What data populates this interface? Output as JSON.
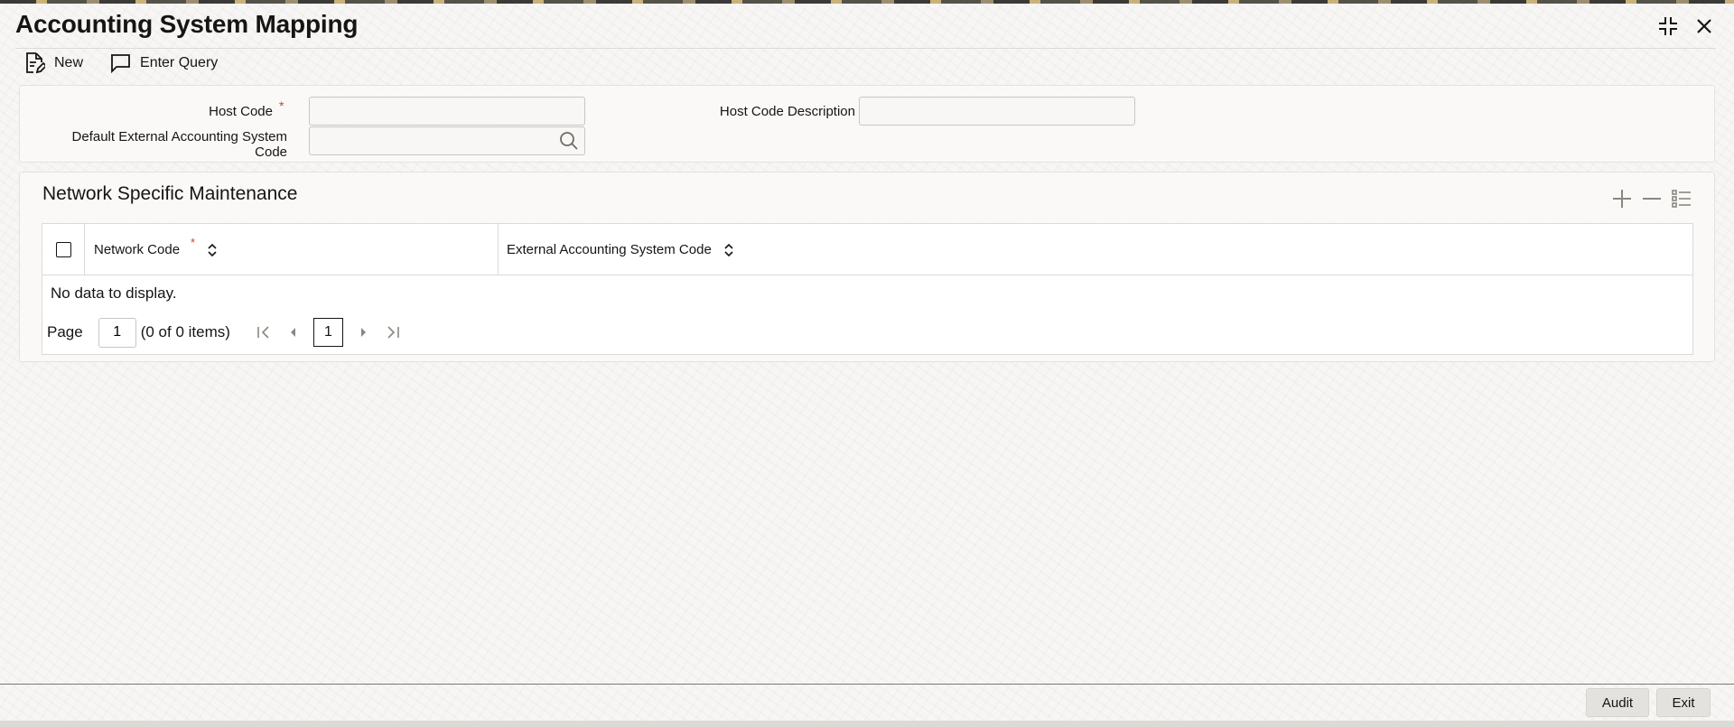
{
  "window": {
    "title": "Accounting System Mapping",
    "controls": {
      "minimize_icon": "collapse-icon",
      "close_icon": "close-icon"
    }
  },
  "toolbar": {
    "new_label": "New",
    "enter_query_label": "Enter Query"
  },
  "form": {
    "host_code": {
      "label": "Host Code",
      "required": "*",
      "value": ""
    },
    "host_code_description": {
      "label": "Host Code Description",
      "value": ""
    },
    "default_ext_acct_code": {
      "label_line1": "Default External Accounting System",
      "label_line2": "Code",
      "value": ""
    }
  },
  "network_section": {
    "title": "Network Specific Maintenance",
    "columns": [
      {
        "label": "Network Code",
        "required": "*"
      },
      {
        "label": "External Accounting System Code"
      }
    ],
    "rows": [],
    "empty_message": "No data to display.",
    "pagination": {
      "page_label": "Page",
      "page_value": "1",
      "items_summary": "(0 of 0 items)",
      "current_page": "1"
    }
  },
  "footer": {
    "audit_label": "Audit",
    "exit_label": "Exit"
  },
  "colors": {
    "required": "#c74634",
    "text": "#161513",
    "border": "#c8c6c2"
  }
}
